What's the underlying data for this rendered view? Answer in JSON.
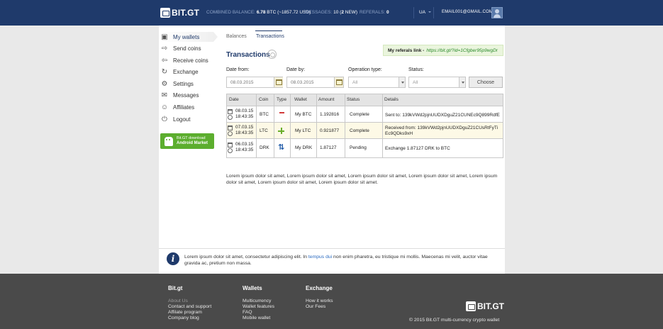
{
  "header": {
    "logo_text": "BIT.GT",
    "combined_label": "COMBINED BALANCE:",
    "combined_value": "6.78",
    "combined_unit": "BTC (~1857.72 USD)",
    "messages_label": "MESSAGES:",
    "messages_value": "10 (",
    "messages_new": "2",
    "messages_suffix": " NEW)",
    "referals_label": "REFERALS:",
    "referals_value": "0",
    "language": "UA",
    "email": "EMAIL001@GMAIL.COM"
  },
  "sidebar": {
    "items": [
      {
        "label": "My wallets",
        "icon": "wallet-icon"
      },
      {
        "label": "Send coins",
        "icon": "send-icon"
      },
      {
        "label": "Receive coins",
        "icon": "receive-icon"
      },
      {
        "label": "Exchange",
        "icon": "exchange-icon"
      },
      {
        "label": "Settings",
        "icon": "gear-icon"
      },
      {
        "label": "Messages",
        "icon": "message-icon"
      },
      {
        "label": "Affiliates",
        "icon": "affiliates-icon"
      },
      {
        "label": "Logout",
        "icon": "power-icon"
      }
    ],
    "android_line1": "Bit.GT download",
    "android_line2": "Android Market"
  },
  "tabs": [
    {
      "label": "Balances"
    },
    {
      "label": "Transactions",
      "active": true
    }
  ],
  "section_title": "Transactions",
  "referral": {
    "label": "My referals link -",
    "url": "https://bit.gt/?id=1Cfgber95p9wgDr"
  },
  "filters": {
    "date_from_label": "Date from:",
    "date_from_placeholder": "08.03.2015",
    "date_by_label": "Date by:",
    "date_by_placeholder": "08.03.2015",
    "operation_label": "Operation type:",
    "operation_value": "All",
    "status_label": "Status:",
    "status_value": "All",
    "choose_label": "Choose"
  },
  "table": {
    "headers": [
      "Date",
      "Coin",
      "Type",
      "Wallet",
      "Amount",
      "Status",
      "Details"
    ],
    "rows": [
      {
        "date": "08.03.15",
        "time": "18:43:35",
        "coin": "BTC",
        "type": "send",
        "wallet": "My BTC",
        "amount": "1.192816",
        "status": "Complete",
        "details1": "Sent to: 139kVWd2pjnUUDXDguZ21CUNEc9Q899RdfE",
        "details2": ""
      },
      {
        "date": "07.03.15",
        "time": "18:43:35",
        "coin": "LTC",
        "type": "receive",
        "wallet": "My LTC",
        "amount": "0.921877",
        "status": "Complete",
        "details1": "Received from: 139kVWd2pjnUUDXDguZ21CUsRtFyTi",
        "details2": "Ec9QDks9xH"
      },
      {
        "date": "06.03.15",
        "time": "18:43:35",
        "coin": "DRK",
        "type": "exchange",
        "wallet": "My DRK",
        "amount": "1.87127",
        "status": "Pending",
        "details1": "Exchange 1.87127 DRK to BTC",
        "details2": ""
      }
    ]
  },
  "lorem": "Lorem ipsum dolor sit amet, Lorem ipsum dolor sit amet, Lorem ipsum dolor sit amet, Lorem ipsum dolor sit amet, Lorem ipsum dolor sit amet, Lorem ipsum dolor sit amet, Lorem ipsum dolor sit amet.",
  "info": {
    "text_before": "Lorem ipsum dolor sit amet, consectetur adipiscing elit. In ",
    "link": "tempus dui",
    "text_after": " non enim pharetra, eu tristique mi mollis. Maecenas mi velit, auctor vitae gravida ac, pretium non massa."
  },
  "footer": {
    "col1_title": "Bit.gt",
    "col1_links": [
      "About Us",
      "Contact and support",
      "Affilate program",
      "Company blog"
    ],
    "col2_title": "Wallets",
    "col2_links": [
      "Multicurrency",
      "Wallet features",
      "FAQ",
      "Mobile wallet"
    ],
    "col3_title": "Exchange",
    "col3_links": [
      "How it works",
      "Our Fees"
    ],
    "logo_text": "BIT.GT",
    "copyright": "© 2015 Bit.GT multi-currency crypto wallet"
  },
  "colors": {
    "header_bg": "#1f3a6b",
    "footer_bg": "#4a4a4a",
    "accent_green": "#5cae2e",
    "send_red": "#d23a3a",
    "link_blue": "#2a6ac0"
  }
}
